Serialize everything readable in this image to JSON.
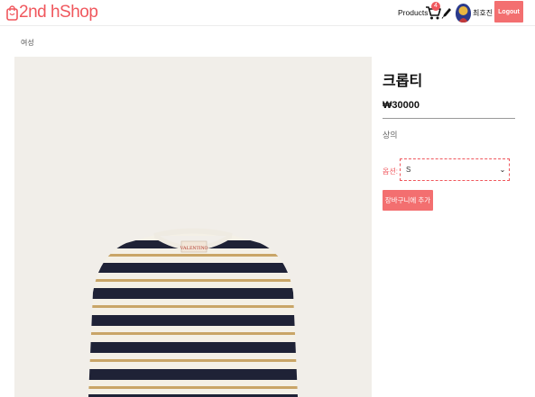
{
  "header": {
    "logo_text": "2nd hShop",
    "products_label": "Products",
    "cart_count": "4",
    "username": "최호진",
    "logout_label": "Logout",
    "icons": [
      "shopping-bag-icon",
      "cart-icon",
      "pencil-icon",
      "avatar"
    ]
  },
  "breadcrumb": {
    "category": "여성"
  },
  "product": {
    "name": "크롭티",
    "price": "₩30000",
    "category": "상의",
    "option_label": "옵션:",
    "option_selected": "S",
    "add_to_cart_label": "장바구니에 추가",
    "image_label": "VALENTINO"
  },
  "colors": {
    "brand": "#f0575d",
    "button": "#f36f70",
    "image_background": "#f1eee9",
    "stripe_navy": "#1f2236",
    "stripe_cream": "#f4f0e6",
    "stripe_gold": "#c9a567"
  }
}
